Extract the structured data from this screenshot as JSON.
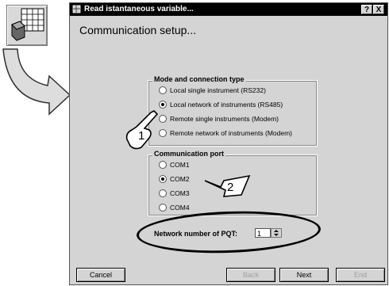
{
  "window": {
    "title": "Read istantaneous variable...",
    "help_label": "?",
    "close_label": "X",
    "heading": "Communication setup..."
  },
  "mode_group": {
    "legend": "Mode and connection type",
    "options": [
      {
        "label": "Local single instrument (RS232)",
        "selected": false
      },
      {
        "label": "Local network of instruments (RS485)",
        "selected": true
      },
      {
        "label": "Remote single instruments (Modem)",
        "selected": false
      },
      {
        "label": "Remote network of instruments (Modem)",
        "selected": false
      }
    ]
  },
  "port_group": {
    "legend": "Communication port",
    "options": [
      {
        "label": "COM1",
        "selected": false
      },
      {
        "label": "COM2",
        "selected": true
      },
      {
        "label": "COM3",
        "selected": false
      },
      {
        "label": "COM4",
        "selected": false
      }
    ]
  },
  "network": {
    "label": "Network number of PQT:",
    "value": "1"
  },
  "buttons": {
    "cancel": "Cancel",
    "back": "Back",
    "next": "Next",
    "end": "End"
  },
  "callouts": {
    "one": "1",
    "two": "2"
  }
}
